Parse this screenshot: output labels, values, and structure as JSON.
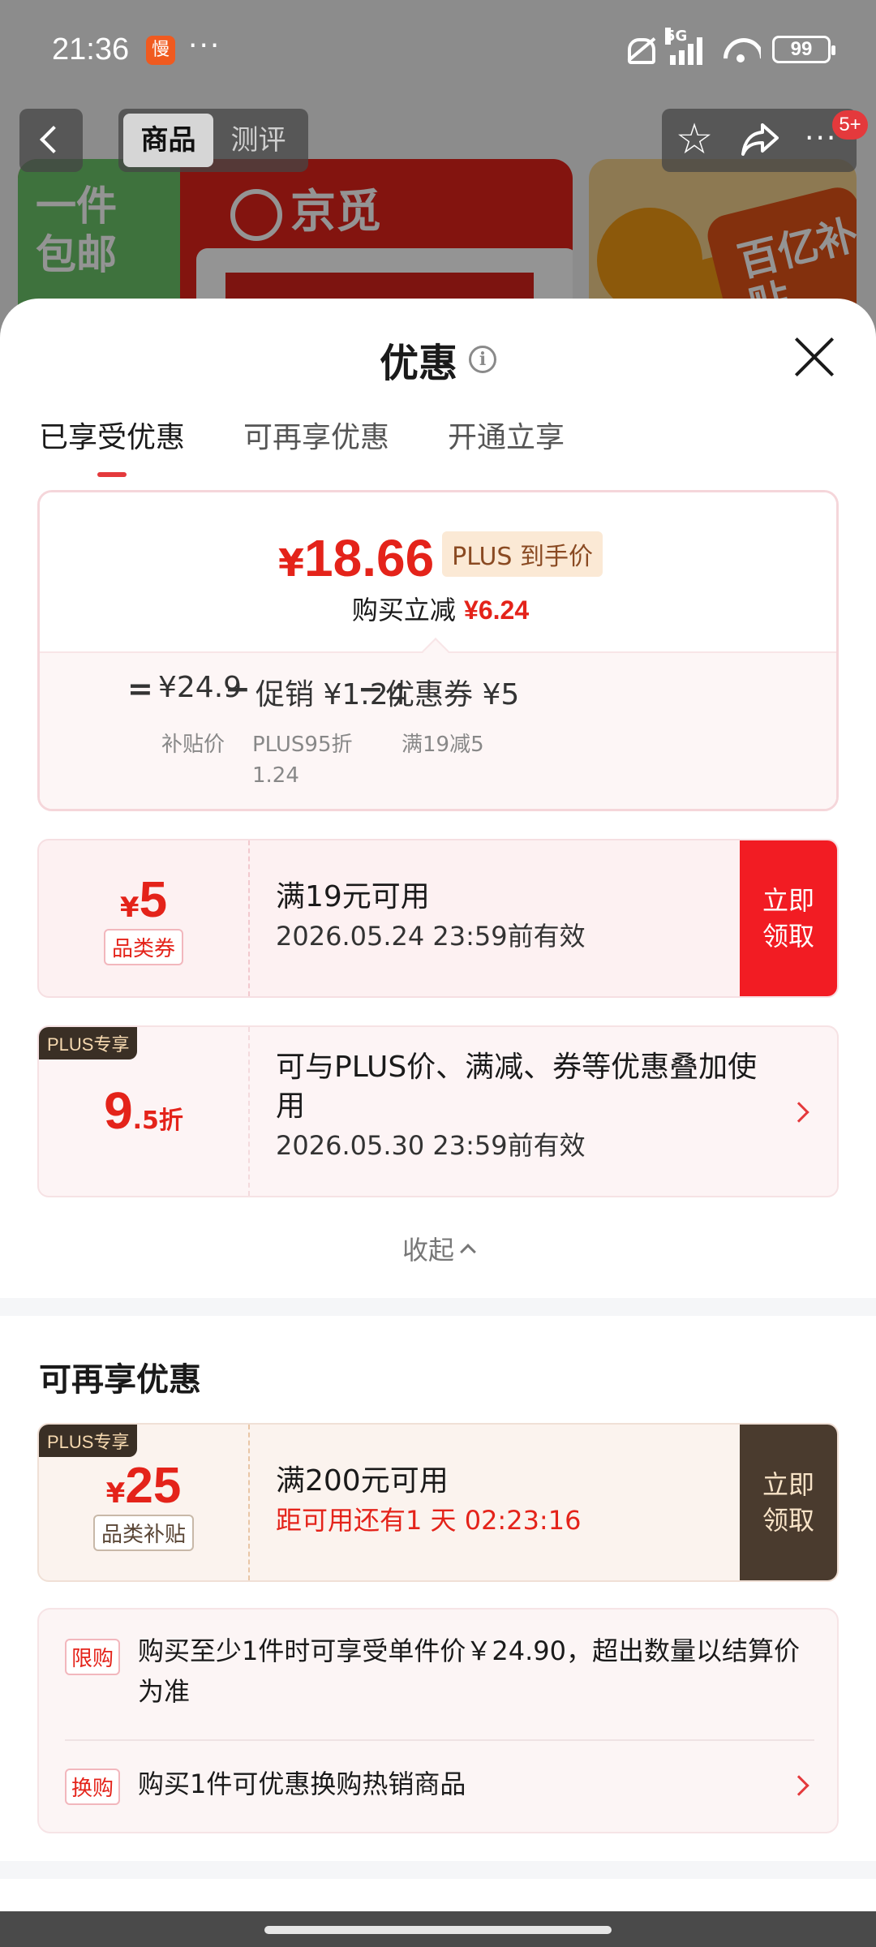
{
  "status_bar": {
    "time": "21:36",
    "app_icon_text": "慢",
    "more": "···",
    "network": "5G",
    "battery": "99"
  },
  "nav": {
    "tabs": [
      "商品",
      "测评"
    ],
    "active_tab": "商品",
    "message_count": "5+"
  },
  "background": {
    "banner_left_text": "一件包邮",
    "banner_brand": "京觅",
    "banner_right_text": "百亿补贴"
  },
  "sheet": {
    "title": "优惠",
    "tabs": [
      "已享受优惠",
      "可再享优惠",
      "开通立享"
    ],
    "summary": {
      "currency": "¥",
      "final_price": "18.66",
      "plus_tag": "PLUS 到手价",
      "reduce_label": "购买立减",
      "reduce_value": "¥6.24",
      "eq": "=",
      "base_price": "¥24.9",
      "minus1": "−",
      "promo": "促销 ¥1.24",
      "minus2": "−",
      "coupon": "优惠券 ¥5",
      "base_label": "补贴价",
      "promo_label_1": "PLUS95折",
      "promo_label_2": "1.24",
      "coupon_label": "满19减5"
    },
    "coupon1": {
      "currency": "¥",
      "amount": "5",
      "type": "品类券",
      "condition": "满19元可用",
      "expiry": "2026.05.24 23:59前有效",
      "button": "立即领取"
    },
    "plus_discount": {
      "corner": "PLUS专享",
      "big": "9",
      "small": ".5折",
      "desc": "可与PLUS价、满减、券等优惠叠加使用",
      "expiry": "2026.05.30 23:59前有效"
    },
    "collapse": "收起",
    "more_section_title": "可再享优惠",
    "coupon2": {
      "corner": "PLUS专享",
      "currency": "¥",
      "amount": "25",
      "type": "品类补贴",
      "condition": "满200元可用",
      "countdown": "距可用还有1 天 02:23:16",
      "button": "立即领取"
    },
    "rules": [
      {
        "tag": "限购",
        "text": "购买至少1件时可享受单件价￥24.90，超出数量以结算价为准"
      },
      {
        "tag": "换购",
        "text": "购买1件可优惠换购热销商品"
      }
    ]
  }
}
